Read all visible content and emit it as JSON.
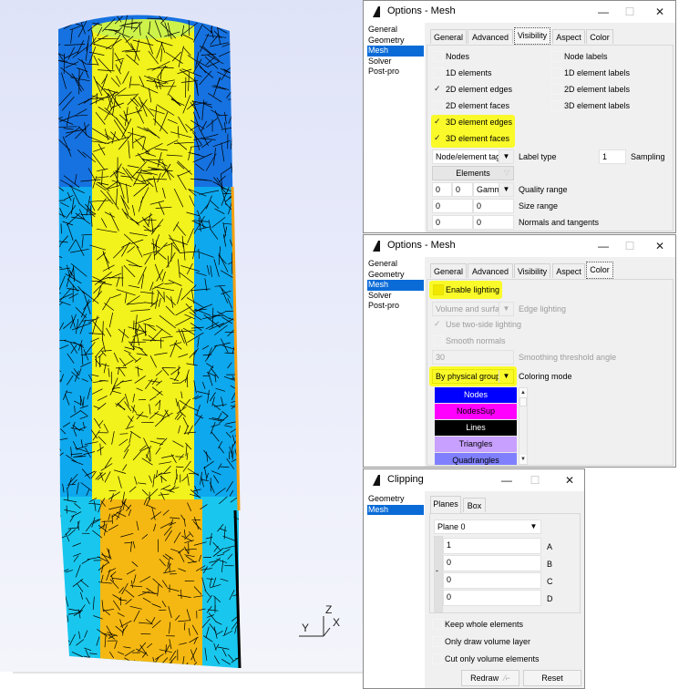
{
  "viewport": {
    "axes": {
      "z": "Z",
      "y": "Y",
      "x": "X"
    },
    "colors": {
      "background": "#e4e7fa",
      "outer_top": "#1672e0",
      "outer_bottom": "#17bff0",
      "inner_top": "#f6f61e",
      "inner_bottom": "#f5b910",
      "mesh_lines": "#000000"
    }
  },
  "window1": {
    "title": "Options - Mesh",
    "controls": {
      "minimize": "—",
      "maximize": "☐",
      "close": "✕"
    },
    "sidebar": [
      "General",
      "Geometry",
      "Mesh",
      "Solver",
      "Post-pro"
    ],
    "sidebar_selected": "Mesh",
    "tabs": [
      "General",
      "Advanced",
      "Visibility",
      "Aspect",
      "Color"
    ],
    "active_tab": "Visibility",
    "checkboxes_left": [
      {
        "label": "Nodes",
        "checked": false
      },
      {
        "label": "1D elements",
        "checked": false
      },
      {
        "label": "2D element edges",
        "checked": true
      },
      {
        "label": "2D element faces",
        "checked": false
      },
      {
        "label": "3D element edges",
        "checked": true,
        "highlighted": true
      },
      {
        "label": "3D element faces",
        "checked": true,
        "highlighted": true
      }
    ],
    "checkboxes_right": [
      {
        "label": "Node labels",
        "checked": false
      },
      {
        "label": "1D element labels",
        "checked": false
      },
      {
        "label": "2D element labels",
        "checked": false
      },
      {
        "label": "3D element labels",
        "checked": false
      }
    ],
    "label_type": {
      "value": "Node/element tag",
      "label": "Label type"
    },
    "sampling": {
      "value": "1",
      "label": "Sampling"
    },
    "elements_button": "Elements",
    "quality_range": {
      "min": "0",
      "max": "0",
      "mode": "Gamm",
      "label": "Quality range"
    },
    "size_range": {
      "min": "0",
      "max": "0",
      "label": "Size range"
    },
    "normals": {
      "a": "0",
      "b": "0",
      "label": "Normals and tangents"
    }
  },
  "window2": {
    "title": "Options - Mesh",
    "controls": {
      "minimize": "—",
      "maximize": "☐",
      "close": "✕"
    },
    "sidebar": [
      "General",
      "Geometry",
      "Mesh",
      "Solver",
      "Post-pro"
    ],
    "sidebar_selected": "Mesh",
    "tabs": [
      "General",
      "Advanced",
      "Visibility",
      "Aspect",
      "Color"
    ],
    "active_tab": "Color",
    "enable_lighting": {
      "label": "Enable lighting",
      "checked": false,
      "highlighted": true
    },
    "edge_lighting": {
      "value": "Volume and surfa",
      "label": "Edge lighting",
      "disabled": true
    },
    "two_side": {
      "label": "Use two-side lighting",
      "checked": true,
      "disabled": true
    },
    "smooth_normals": {
      "label": "Smooth normals",
      "checked": false,
      "disabled": true
    },
    "smoothing_angle": {
      "value": "30",
      "label": "Smoothing threshold angle",
      "disabled": true
    },
    "coloring_mode": {
      "value": "By physical group",
      "label": "Coloring mode",
      "highlighted": true
    },
    "color_list": [
      {
        "label": "Nodes",
        "bg": "#0000ff",
        "fg": "#ffffff"
      },
      {
        "label": "NodesSup",
        "bg": "#ff00ff",
        "fg": "#000000"
      },
      {
        "label": "Lines",
        "bg": "#000000",
        "fg": "#ffffff"
      },
      {
        "label": "Triangles",
        "bg": "#c8a0ff",
        "fg": "#000000"
      },
      {
        "label": "Quadrangles",
        "bg": "#8080ff",
        "fg": "#000000"
      }
    ]
  },
  "window3": {
    "title": "Clipping",
    "controls": {
      "minimize": "—",
      "maximize": "☐",
      "close": "✕"
    },
    "sidebar": [
      "Geometry",
      "Mesh"
    ],
    "sidebar_selected": "Mesh",
    "tabs": [
      "Planes",
      "Box"
    ],
    "active_tab": "Planes",
    "plane_select": "Plane 0",
    "coefficients": [
      {
        "value": "1",
        "label": "A"
      },
      {
        "value": "0",
        "label": "B"
      },
      {
        "value": "0",
        "label": "C"
      },
      {
        "value": "0",
        "label": "D"
      }
    ],
    "minus_label": "-",
    "options": [
      {
        "label": "Keep whole elements",
        "checked": false
      },
      {
        "label": "Only draw volume layer",
        "checked": false
      },
      {
        "label": "Cut only volume elements",
        "checked": false
      }
    ],
    "redraw_button": "Redraw",
    "reset_button": "Reset"
  }
}
